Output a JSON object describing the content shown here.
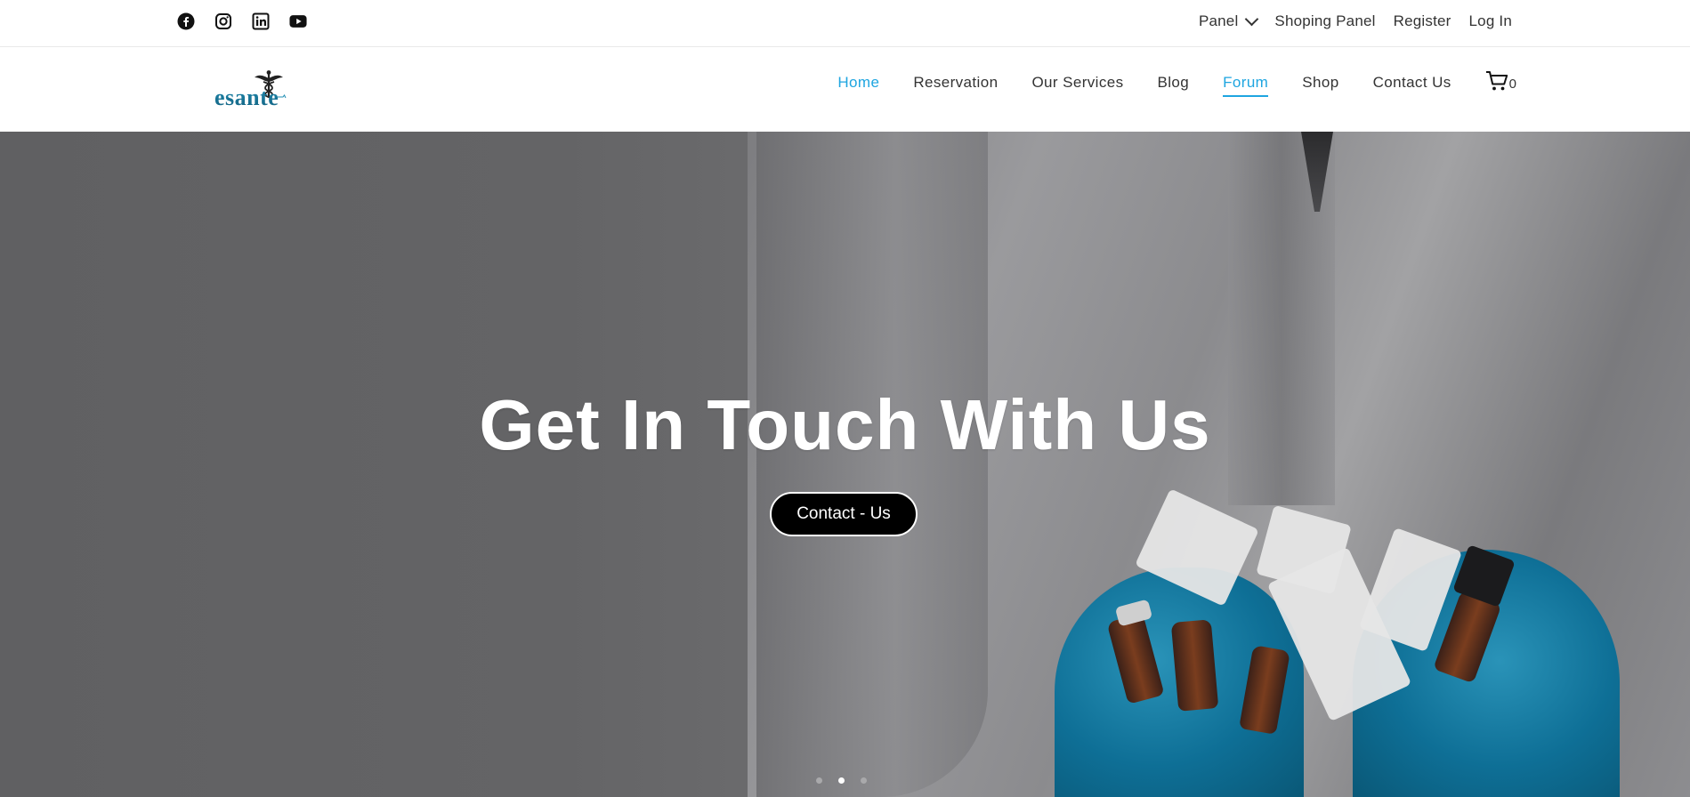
{
  "topbar": {
    "social": [
      {
        "icon": "facebook-icon"
      },
      {
        "icon": "instagram-icon"
      },
      {
        "icon": "linkedin-icon"
      },
      {
        "icon": "youtube-icon"
      }
    ],
    "links": {
      "panel": "Panel",
      "shoping_panel": "Shoping Panel",
      "register": "Register",
      "login": "Log In"
    }
  },
  "header": {
    "logo_text": "esante",
    "nav": [
      "Home",
      "Reservation",
      "Our Services",
      "Blog",
      "Forum",
      "Shop",
      "Contact Us"
    ],
    "active_item": "Home",
    "underlined_item": "Forum",
    "cart_count": "0",
    "accent_color": "#1ea5e0"
  },
  "hero": {
    "title": "Get In Touch With Us",
    "button_label": "Contact - Us",
    "slides_total": 3,
    "slide_active": 2
  }
}
